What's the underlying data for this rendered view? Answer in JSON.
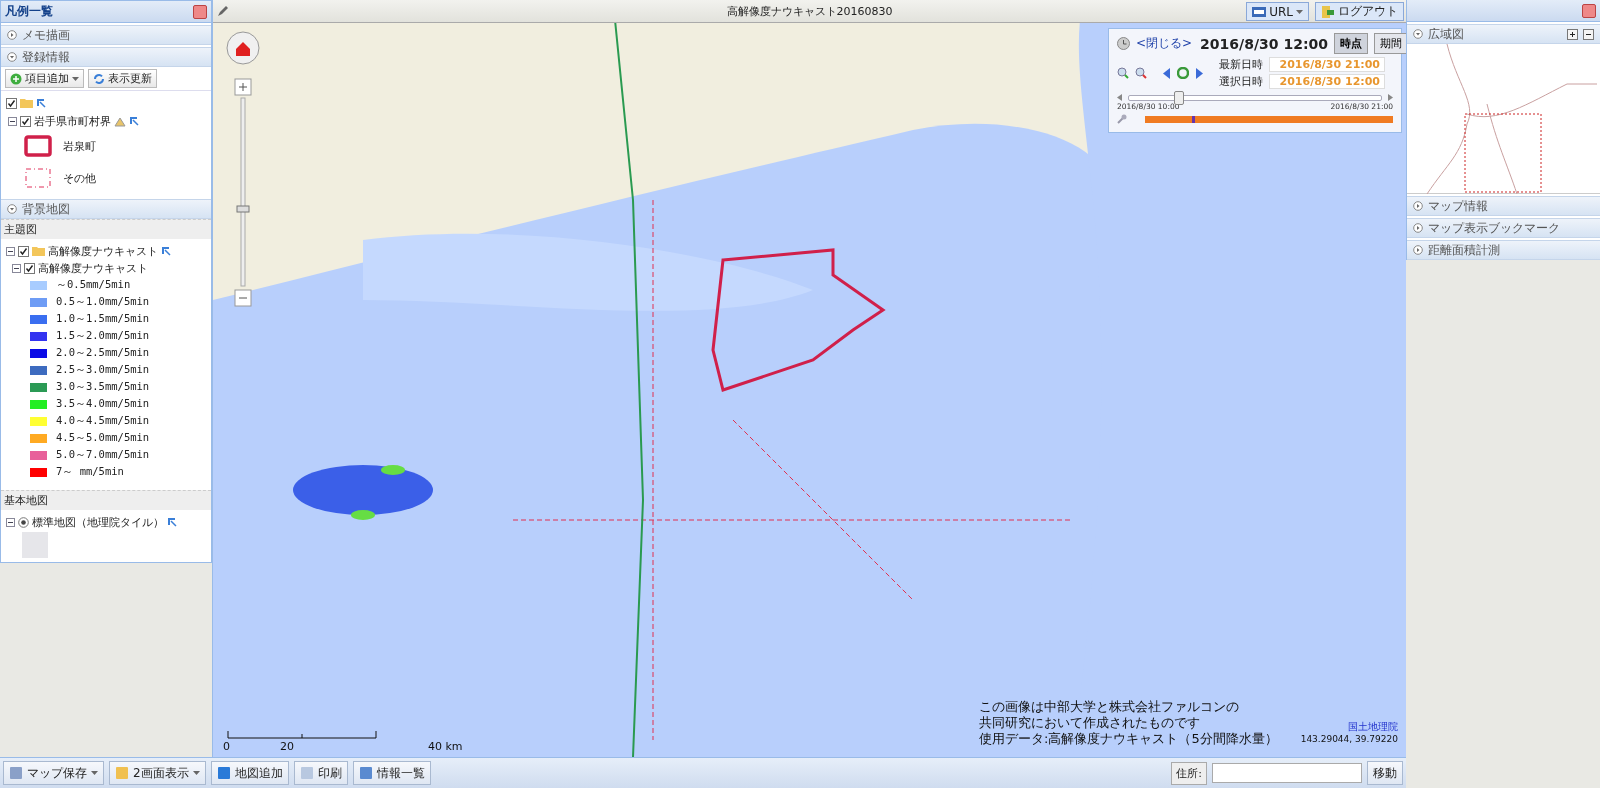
{
  "legend_panel": {
    "title": "凡例一覧",
    "memo_section": {
      "title": "メモ描画",
      "expanded": false
    },
    "registered_section": {
      "title": "登録情報",
      "expanded": true,
      "buttons": [
        {
          "label": "項目追加",
          "kind": "dropdown"
        },
        {
          "label": "表示更新",
          "kind": "plain"
        }
      ],
      "folder": {
        "checked": true,
        "children": [
          {
            "label": "岩手県市町村界",
            "checked": true,
            "legend": [
              {
                "label": "岩泉町",
                "kind": "solid"
              },
              {
                "label": "その他",
                "kind": "dashed"
              }
            ]
          }
        ]
      }
    },
    "background_section": {
      "title": "背景地図",
      "expanded": true
    },
    "theme_heading": "主題図",
    "theme_folder": {
      "label": "高解像度ナウキャスト",
      "checked": true,
      "layer": {
        "label": "高解像度ナウキャスト",
        "checked": true,
        "legend": [
          {
            "label": "～0.5mm/5min",
            "color": "#a8ccff"
          },
          {
            "label": "0.5～1.0mm/5min",
            "color": "#6e9cf5"
          },
          {
            "label": "1.0～1.5mm/5min",
            "color": "#3a6ef0"
          },
          {
            "label": "1.5～2.0mm/5min",
            "color": "#3333f0"
          },
          {
            "label": "2.0～2.5mm/5min",
            "color": "#0a0ae6"
          },
          {
            "label": "2.5～3.0mm/5min",
            "color": "#3d6bbf"
          },
          {
            "label": "3.0～3.5mm/5min",
            "color": "#2b9a55"
          },
          {
            "label": "3.5～4.0mm/5min",
            "color": "#22ee22"
          },
          {
            "label": "4.0～4.5mm/5min",
            "color": "#ffff33"
          },
          {
            "label": "4.5～5.0mm/5min",
            "color": "#ffaa22"
          },
          {
            "label": "5.0～7.0mm/5min",
            "color": "#e8609a"
          },
          {
            "label": "7～ mm/5min",
            "color": "#ff0000"
          }
        ]
      }
    },
    "base_heading": "基本地図",
    "base_layers": [
      {
        "label": "標準地図（地理院タイル）",
        "selected": true
      }
    ]
  },
  "map": {
    "title": "高解像度ナウキャスト20160830",
    "url_button": "URL",
    "logout_button": "ログアウト",
    "scale_labels": [
      "0",
      "20",
      "40 km"
    ],
    "caption": [
      "この画像は中部大学と株式会社ファルコンの",
      "共同研究において作成されたものです",
      "使用データ:高解像度ナウキャスト（5分間降水量）"
    ],
    "attribution": "国土地理院",
    "coordinates": "143.29044, 39.79220"
  },
  "time_panel": {
    "close_link": "<閉じる>",
    "datetime": "2016/8/30 12:00",
    "modes": [
      {
        "label": "時点",
        "selected": true
      },
      {
        "label": "期間",
        "selected": false
      }
    ],
    "latest_label": "最新日時",
    "latest_value": "2016/8/30 21:00",
    "selected_label": "選択日時",
    "selected_value": "2016/8/30 12:00",
    "slider": {
      "level": 0.2,
      "start": "2016/8/30 10:00",
      "end": "2016/8/30 21:00"
    },
    "timeline": {
      "level": 0.19
    }
  },
  "right_panel": {
    "overview": {
      "title": "広域図",
      "expanded": true
    },
    "sections": [
      {
        "title": "マップ情報",
        "expanded": false
      },
      {
        "title": "マップ表示ブックマーク",
        "expanded": false
      },
      {
        "title": "距離面積計測",
        "expanded": false
      }
    ]
  },
  "bottom_bar": {
    "buttons": [
      {
        "label": "マップ保存",
        "kind": "dropdown"
      },
      {
        "label": "2画面表示",
        "kind": "dropdown"
      },
      {
        "label": "地図追加",
        "kind": "plain"
      },
      {
        "label": "印刷",
        "kind": "plain"
      },
      {
        "label": "情報一覧",
        "kind": "plain"
      }
    ],
    "address_label": "住所:",
    "move_button": "移動"
  }
}
